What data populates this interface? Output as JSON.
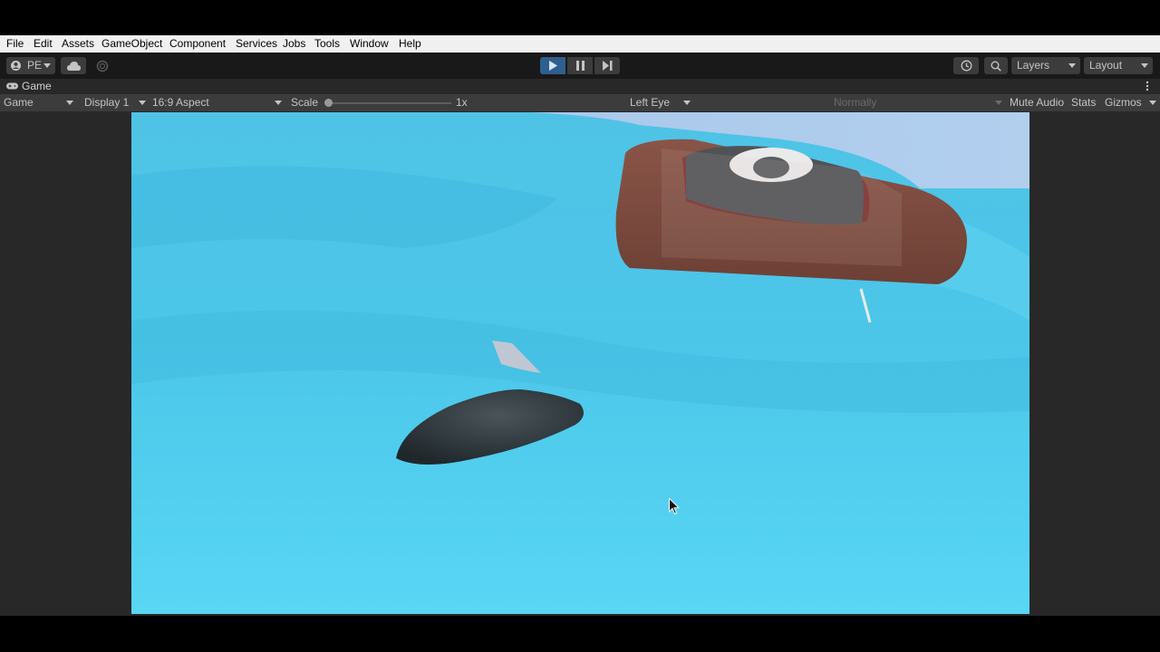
{
  "menu": [
    "File",
    "Edit",
    "Assets",
    "GameObject",
    "Component",
    "Services",
    "Jobs",
    "Tools",
    "Window",
    "Help"
  ],
  "toolbar": {
    "account_label": "PE",
    "layers_label": "Layers",
    "layout_label": "Layout"
  },
  "tab": {
    "label": "Game"
  },
  "gamebar": {
    "mode": "Game",
    "display": "Display 1",
    "aspect": "16:9 Aspect",
    "scale_label": "Scale",
    "scale_value": "1x",
    "eye": "Left Eye",
    "play_focus": "Normally",
    "mute_audio": "Mute Audio",
    "stats": "Stats",
    "gizmos": "Gizmos"
  },
  "colors": {
    "play_active": "#2f5f8f",
    "water": "#4cc8e8",
    "sky": "#a9c8ec"
  },
  "icons": {
    "account": "account-icon",
    "cloud": "cloud-icon",
    "collab": "collab-icon",
    "play": "play-icon",
    "pause": "pause-icon",
    "step": "step-icon",
    "history": "history-icon",
    "search": "search-icon",
    "gamepad": "gamepad-icon",
    "more": "more-icon",
    "cursor": "mouse-cursor-icon"
  }
}
